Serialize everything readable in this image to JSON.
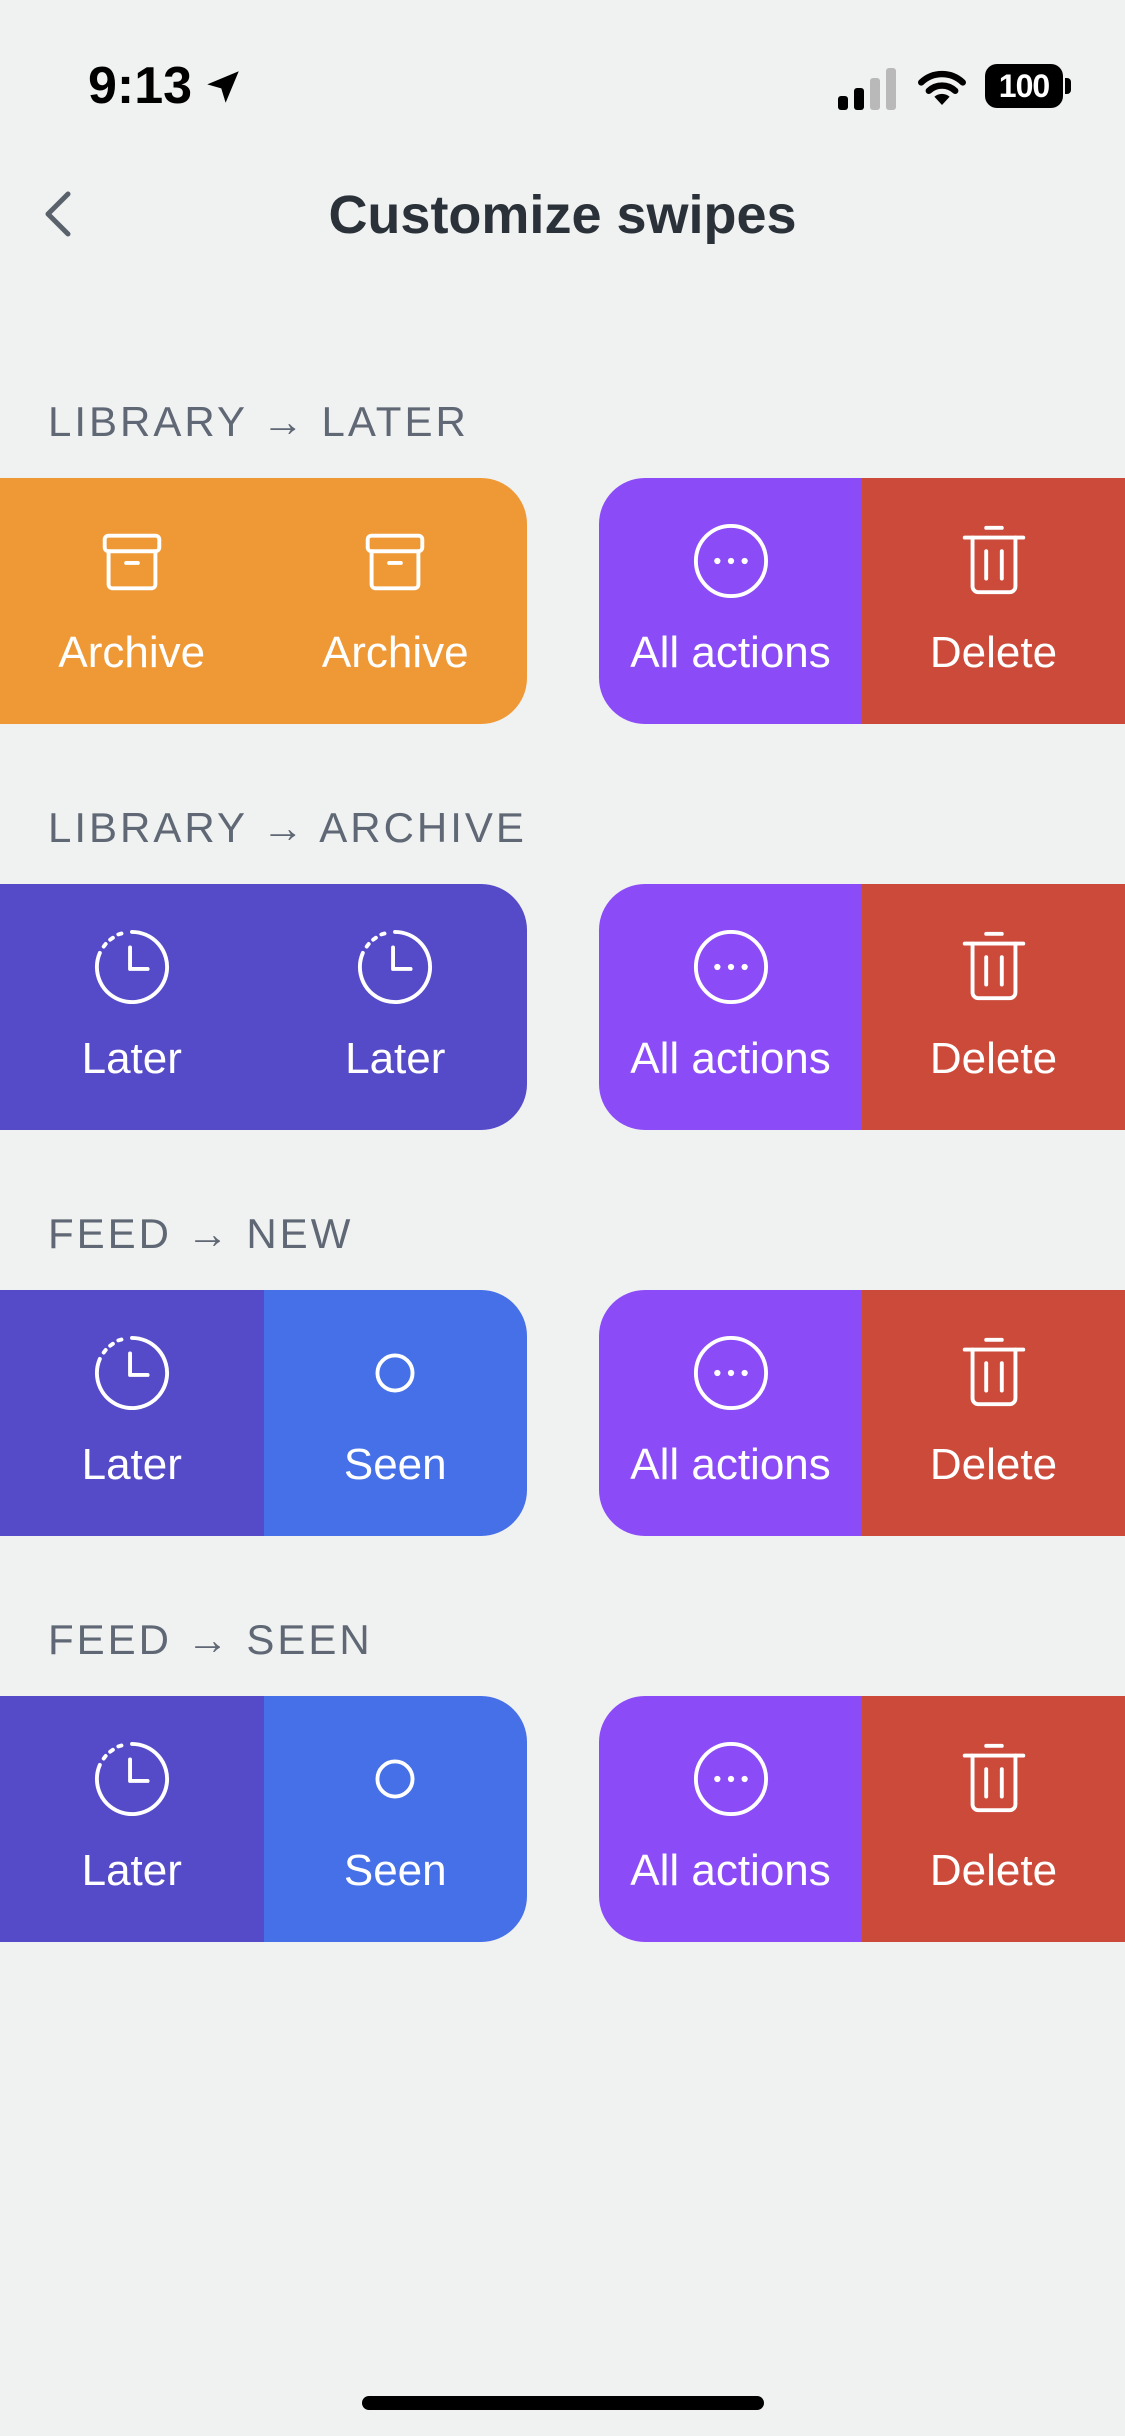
{
  "status_bar": {
    "time": "9:13",
    "battery": "100",
    "icons": [
      "location-arrow-icon",
      "cellular-signal-icon",
      "wifi-icon",
      "battery-icon"
    ]
  },
  "header": {
    "title": "Customize swipes",
    "back_icon": "chevron-left-icon"
  },
  "colors": {
    "background": "#f0f1f1",
    "archive": "#ef9936",
    "later": "#554bc8",
    "seen": "#4570e8",
    "all_actions": "#8b4cf7",
    "delete": "#cc4a39"
  },
  "sections": [
    {
      "label": "LIBRARY → LATER",
      "left": [
        {
          "label": "Archive",
          "icon": "archive-box-icon"
        },
        {
          "label": "Archive",
          "icon": "archive-box-icon"
        }
      ],
      "right": [
        {
          "label": "All actions",
          "icon": "more-circle-icon"
        },
        {
          "label": "Delete",
          "icon": "trash-icon"
        }
      ]
    },
    {
      "label": "LIBRARY → ARCHIVE",
      "left": [
        {
          "label": "Later",
          "icon": "clock-icon"
        },
        {
          "label": "Later",
          "icon": "clock-icon"
        }
      ],
      "right": [
        {
          "label": "All actions",
          "icon": "more-circle-icon"
        },
        {
          "label": "Delete",
          "icon": "trash-icon"
        }
      ]
    },
    {
      "label": "FEED → NEW",
      "left": [
        {
          "label": "Later",
          "icon": "clock-icon"
        },
        {
          "label": "Seen",
          "icon": "circle-icon"
        }
      ],
      "right": [
        {
          "label": "All actions",
          "icon": "more-circle-icon"
        },
        {
          "label": "Delete",
          "icon": "trash-icon"
        }
      ]
    },
    {
      "label": "FEED → SEEN",
      "left": [
        {
          "label": "Later",
          "icon": "clock-icon"
        },
        {
          "label": "Seen",
          "icon": "circle-icon"
        }
      ],
      "right": [
        {
          "label": "All actions",
          "icon": "more-circle-icon"
        },
        {
          "label": "Delete",
          "icon": "trash-icon"
        }
      ]
    }
  ]
}
